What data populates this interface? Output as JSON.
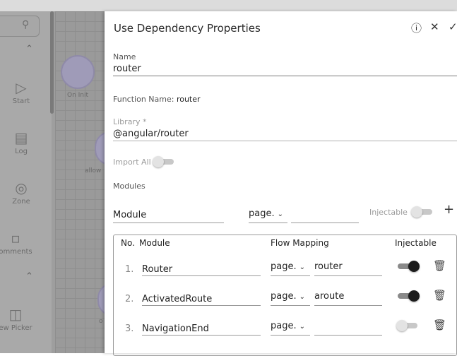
{
  "sidebar": {
    "items": [
      {
        "label": "Start",
        "icon": "play-icon"
      },
      {
        "label": "Log",
        "icon": "log-icon"
      },
      {
        "label": "Zone",
        "icon": "zone-icon"
      },
      {
        "label": "omments",
        "icon": "comments-icon"
      },
      {
        "label": "ew Picker",
        "icon": "view-picker-icon"
      }
    ]
  },
  "canvas": {
    "nodes": [
      {
        "label": "On Init"
      },
      {
        "label": "allow"
      },
      {
        "label": "o"
      }
    ]
  },
  "panel": {
    "title": "Use Dependency Properties",
    "name_label": "Name",
    "name_value": "router",
    "function_name_label": "Function Name:",
    "function_name_value": "router",
    "library_label": "Library *",
    "library_value": "@angular/router",
    "import_all_label": "Import All",
    "modules_label": "Modules",
    "new_module": {
      "module_placeholder": "Module",
      "flow_value": "page.",
      "injectable_label": "Injectable"
    },
    "table": {
      "headers": {
        "no": "No.",
        "module": "Module",
        "flow": "Flow Mapping",
        "injectable": "Injectable"
      },
      "rows": [
        {
          "no": "1.",
          "module": "Router",
          "flow": "page.",
          "mapping": "router",
          "injectable": true
        },
        {
          "no": "2.",
          "module": "ActivatedRoute",
          "flow": "page.",
          "mapping": "aroute",
          "injectable": true
        },
        {
          "no": "3.",
          "module": "NavigationEnd",
          "flow": "page.",
          "mapping": "",
          "injectable": false
        }
      ]
    }
  }
}
